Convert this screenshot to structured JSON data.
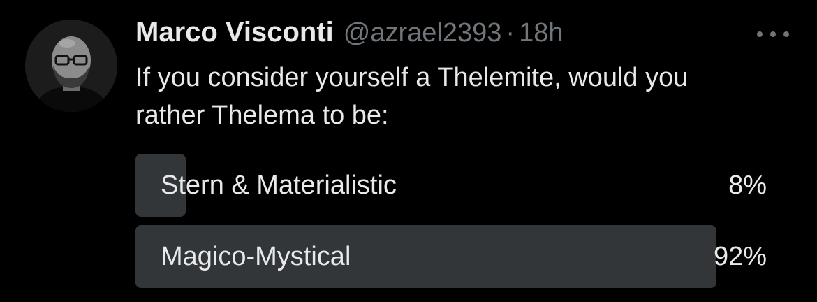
{
  "tweet": {
    "author": {
      "name": "Marco Visconti",
      "handle": "@azrael2393",
      "time": "18h",
      "separator": "·",
      "avatar_icon": "user-avatar"
    },
    "more_icon": "more-dots-icon",
    "text": "If you consider yourself a Thelemite, would you rather Thelema to be:",
    "poll": {
      "options": [
        {
          "label": "Stern & Materialistic",
          "percent_text": "8%",
          "percent": 8
        },
        {
          "label": "Magico-Mystical",
          "percent_text": "92%",
          "percent": 92
        }
      ],
      "bar_color": "#333639"
    }
  },
  "colors": {
    "background": "#000000",
    "primary_text": "#e7e9ea",
    "secondary_text": "#71767b"
  }
}
